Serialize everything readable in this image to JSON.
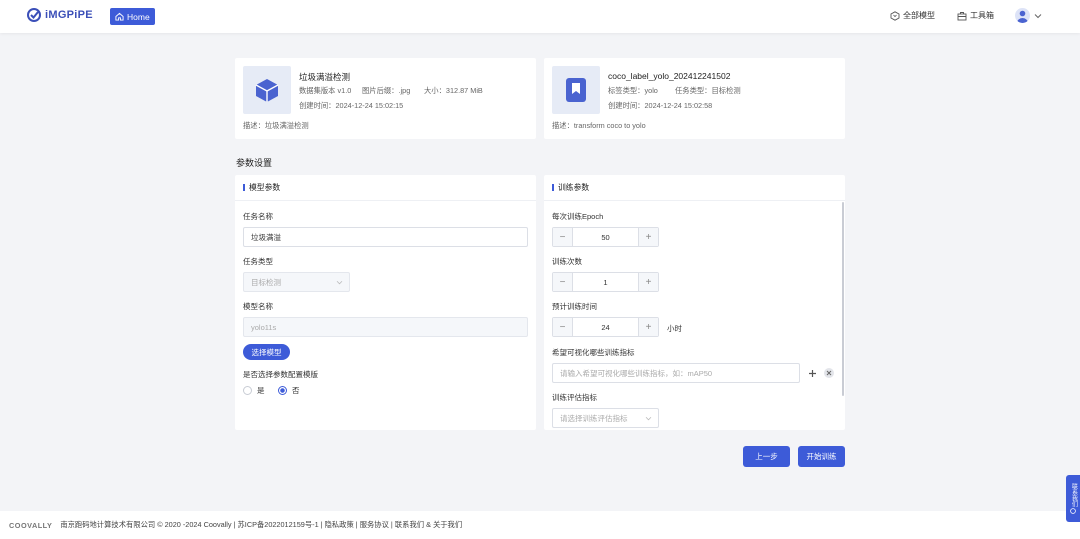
{
  "brand": {
    "name": "iMGPiPE"
  },
  "nav": {
    "home_label": "Home",
    "all_models_label": "全部模型",
    "toolbox_label": "工具箱"
  },
  "dataset_card": {
    "title": "垃圾满溢检测",
    "version": "数据集版本 v1.0",
    "image_format": "图片后缀：.jpg",
    "size": "大小：312.87 MiB",
    "created": "创建时间：2024-12-24 15:02:15",
    "description": "描述：垃圾满溢检测"
  },
  "label_card": {
    "title": "coco_label_yolo_202412241502",
    "label_type": "标签类型：yolo",
    "task_type": "任务类型：目标检测",
    "created": "创建时间：2024-12-24 15:02:58",
    "description": "描述：transform coco to yolo"
  },
  "section_title": "参数设置",
  "model_panel": {
    "header": "模型参数",
    "task_name_label": "任务名称",
    "task_name_value": "垃圾满溢",
    "task_type_label": "任务类型",
    "task_type_value": "目标检测",
    "model_name_label": "模型名称",
    "model_name_value": "yolo11s",
    "select_model_button": "选择模型",
    "param_template_label": "是否选择参数配置模版",
    "radio_yes": "是",
    "radio_no": "否",
    "radio_selected": "否"
  },
  "train_panel": {
    "header": "训练参数",
    "epoch_label": "每次训练Epoch",
    "epoch_value": "50",
    "count_label": "训练次数",
    "count_value": "1",
    "time_label": "预计训练时间",
    "time_value": "24",
    "time_unit": "小时",
    "metrics_label": "希望可视化哪些训练指标",
    "metrics_placeholder": "请输入希望可视化哪些训练指标，如：mAP50",
    "eval_label": "训练评估指标",
    "eval_placeholder": "请选择训练评估指标"
  },
  "actions": {
    "prev_label": "上一步",
    "start_label": "开始训练"
  },
  "footer": {
    "brand": "COOVALLY",
    "text": "南京跑码地计算技术有限公司 © 2020 -2024 Coovally | 苏ICP备2022012159号-1 | 隐私政策 | 服务协议 | 联系我们 & 关于我们"
  },
  "float_contact": {
    "label": "联系我们"
  },
  "colors": {
    "accent": "#3d5bd8",
    "page_bg": "#f3f4f7"
  },
  "icons": [
    "home-icon",
    "hexagon-icon",
    "toolbox-icon",
    "user-icon",
    "cube-icon",
    "bookmark-icon",
    "plus-icon",
    "close-icon",
    "chevron-down-icon"
  ]
}
